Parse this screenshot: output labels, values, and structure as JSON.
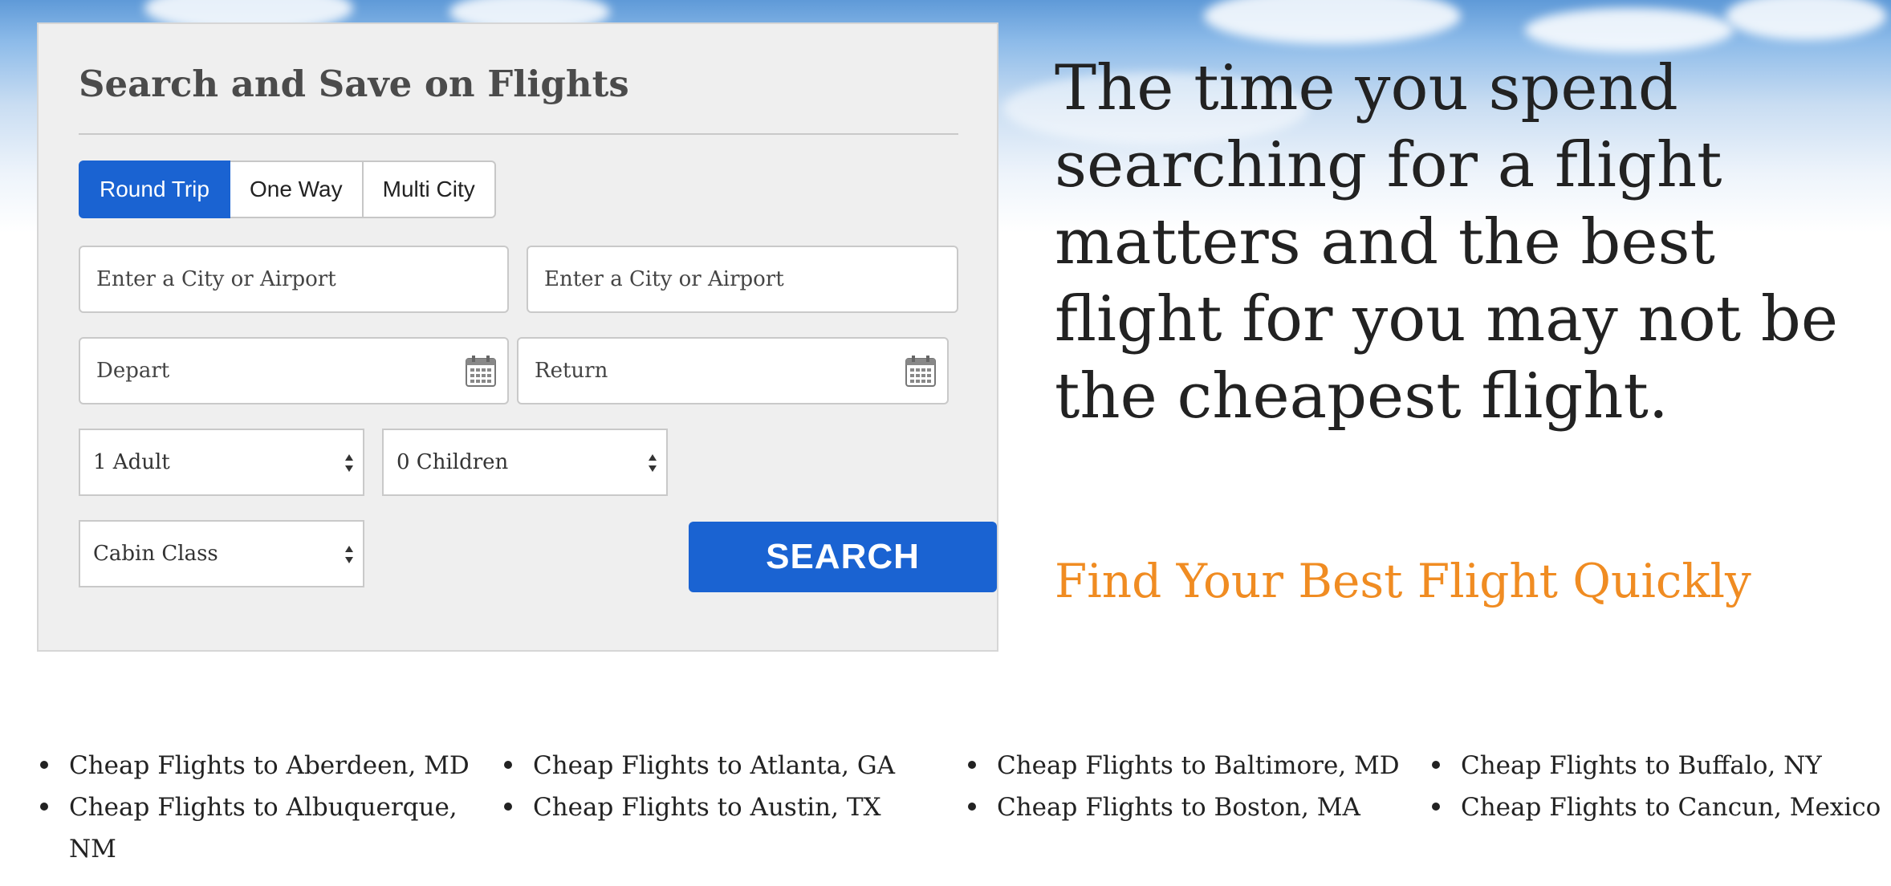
{
  "panel": {
    "title": "Search and Save on Flights",
    "tabs": [
      {
        "label": "Round Trip",
        "active": true
      },
      {
        "label": "One Way",
        "active": false
      },
      {
        "label": "Multi City",
        "active": false
      }
    ],
    "from_placeholder": "Enter a City or Airport",
    "to_placeholder": "Enter a City or Airport",
    "depart_placeholder": "Depart",
    "return_placeholder": "Return",
    "adults": "1 Adult",
    "children": "0 Children",
    "cabin_class": "Cabin Class",
    "search_label": "SEARCH",
    "accent_color": "#1a63d2"
  },
  "headline": "The time you spend searching for a flight matters and the best flight for you may not be the cheapest flight.",
  "subhead": "Find Your Best Flight Quickly",
  "subhead_color": "#f08c22",
  "links": {
    "col1": [
      "Cheap Flights to Aberdeen, MD",
      "Cheap Flights to Albuquerque, NM"
    ],
    "col2": [
      "Cheap Flights to Atlanta, GA",
      "Cheap Flights to Austin, TX"
    ],
    "col3": [
      "Cheap Flights to Baltimore, MD",
      "Cheap Flights to Boston, MA"
    ],
    "col4": [
      "Cheap Flights to Buffalo, NY",
      "Cheap Flights to Cancun, Mexico"
    ]
  }
}
